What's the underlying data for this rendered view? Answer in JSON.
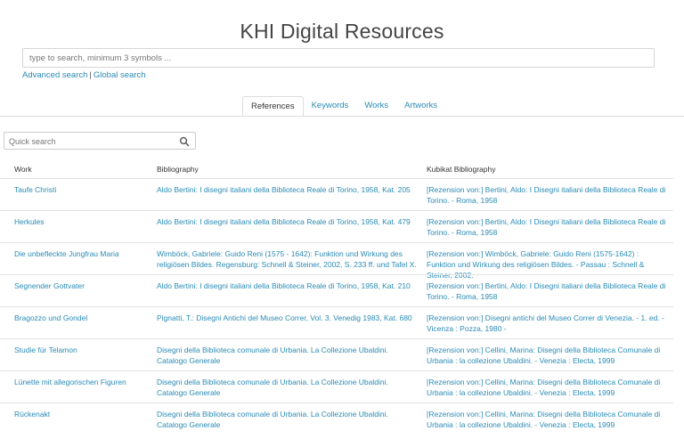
{
  "title": "KHI Digital Resources",
  "search": {
    "placeholder": "type to search, minimum 3 symbols ...",
    "advanced_label": "Advanced search",
    "separator": "|",
    "global_label": "Global search"
  },
  "tabs": [
    {
      "label": "References",
      "active": true
    },
    {
      "label": "Keywords",
      "active": false
    },
    {
      "label": "Works",
      "active": false
    },
    {
      "label": "Artworks",
      "active": false
    }
  ],
  "quick_search": {
    "placeholder": "Quick search",
    "icon": "search-icon"
  },
  "table": {
    "headers": [
      "Work",
      "Bibliography",
      "Kubikat Bibliography"
    ],
    "rows": [
      {
        "work": "Taufe Christi",
        "bibliography": "Aldo Bertini: I disegni italiani della Biblioteca Reale di Torino, 1958, Kat. 205",
        "kubikat": "[Rezension von:] Bertini, Aldo: I Disegni italiani della Biblioteca Reale di Torino. - Roma, 1958"
      },
      {
        "work": "Herkules",
        "bibliography": "Aldo Bertini: I disegni italiani della Biblioteca Reale di Torino, 1958, Kat. 479",
        "kubikat": "[Rezension von:] Bertini, Aldo: I Disegni italiani della Biblioteca Reale di Torino. - Roma, 1958"
      },
      {
        "work": "Die unbefleckte Jungfrau Maria",
        "bibliography": "Wimböck, Gabriele: Guido Reni (1575 - 1642): Funktion und Wirkung des religiösen Bildes. Regensburg: Schnell & Steiner, 2002, S. 233 ff. und Tafel X.",
        "kubikat": "[Rezension von:] Wimböck, Gabriele: Guido Reni (1575-1642) : Funktion und Wirkung des religiösen Bildes. - Passau : Schnell & Steiner, 2002."
      },
      {
        "work": "Segnender Gottvater",
        "bibliography": "Aldo Bertini: I disegni italiani della Biblioteca Reale di Torino, 1958, Kat. 210",
        "kubikat": "[Rezension von:] Bertini, Aldo: I Disegni italiani della Biblioteca Reale di Torino. - Roma, 1958"
      },
      {
        "work": "Bragozzo und Gondel",
        "bibliography": "Pignatti, T.: Disegni Antichi del Museo Correr, Vol. 3. Venedig 1983, Kat. 680",
        "kubikat": "[Rezension von:] Disegni antichi del Museo Correr di Venezia. - 1. ed. - Vicenza : Pozza, 1980 -"
      },
      {
        "work": "Studie für Telamon",
        "bibliography": "Disegni della Biblioteca comunale di Urbania. La Collezione Ubaldini. Catalogo Generale",
        "kubikat": "[Rezension von:] Cellini, Marina: Disegni della Biblioteca Comunale di Urbania : la collezione Ubaldini. - Venezia : Electa, 1999"
      },
      {
        "work": "Lünette mit allegorischen Figuren",
        "bibliography": "Disegni della Biblioteca comunale di Urbania. La Collezione Ubaldini. Catalogo Generale",
        "kubikat": "[Rezension von:] Cellini, Marina: Disegni della Biblioteca Comunale di Urbania : la collezione Ubaldini. - Venezia : Electa, 1999"
      },
      {
        "work": "Rückenakt",
        "bibliography": "Disegni della Biblioteca comunale di Urbania. La Collezione Ubaldini. Catalogo Generale",
        "kubikat": "[Rezension von:] Cellini, Marina: Disegni della Biblioteca Comunale di Urbania : la collezione Ubaldini. - Venezia : Electa, 1999"
      }
    ]
  }
}
